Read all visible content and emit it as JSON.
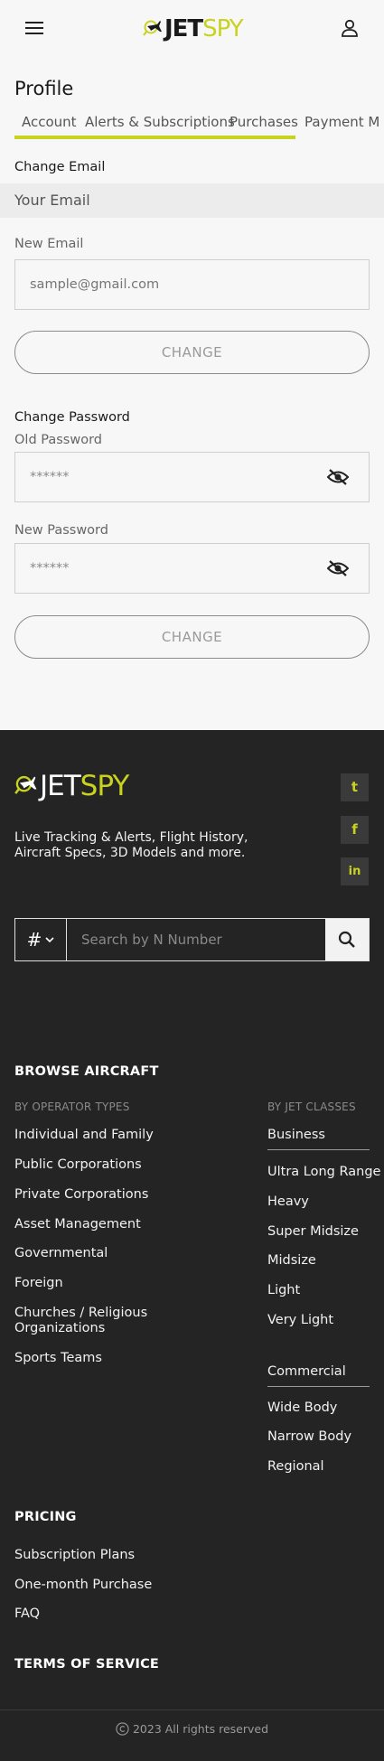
{
  "brand": {
    "jet": "JET",
    "spy": "SPY"
  },
  "profile": {
    "title": "Profile",
    "tabs": [
      "Account",
      "Alerts & Subscriptions",
      "Purchases",
      "Payment M"
    ],
    "email": {
      "section_label": "Change Email",
      "current_value": "Your Email",
      "new_label": "New Email",
      "new_placeholder": "sample@gmail.com",
      "button": "CHANGE"
    },
    "password": {
      "section_label": "Change Password",
      "old_label": "Old Password",
      "old_value": "******",
      "new_label": "New Password",
      "new_value": "******",
      "button": "CHANGE"
    }
  },
  "footer": {
    "tagline": "Live Tracking & Alerts, Flight History, Aircraft Specs, 3D Models and more.",
    "social": [
      {
        "icon": "twitter-icon",
        "glyph": "t"
      },
      {
        "icon": "facebook-icon",
        "glyph": "f"
      },
      {
        "icon": "linkedin-icon",
        "glyph": "in"
      }
    ],
    "search": {
      "type_glyph": "#",
      "placeholder": "Search by N Number"
    },
    "browse_heading": "BROWSE AIRCRAFT",
    "operator_types": {
      "label": "BY OPERATOR TYPES",
      "items": [
        "Individual and Family",
        "Public Corporations",
        "Private Corporations",
        "Asset Management",
        "Governmental",
        "Foreign",
        "Churches / Religious Organizations",
        "Sports Teams"
      ]
    },
    "jet_classes": {
      "label": "BY JET CLASSES",
      "business_header": "Business",
      "business_items": [
        "Ultra Long Range",
        "Heavy",
        "Super Midsize",
        "Midsize",
        "Light",
        "Very Light"
      ],
      "commercial_header": "Commercial",
      "commercial_items": [
        "Wide Body",
        "Narrow Body",
        "Regional"
      ]
    },
    "pricing": {
      "heading": "PRICING",
      "items": [
        "Subscription Plans",
        "One-month Purchase",
        "FAQ"
      ]
    },
    "terms": "TERMS OF SERVICE",
    "copyright": "2023 All rights reserved"
  },
  "colors": {
    "accent": "#c9d31f",
    "footer_bg": "#242424",
    "page_bg": "#f7f7f7"
  }
}
